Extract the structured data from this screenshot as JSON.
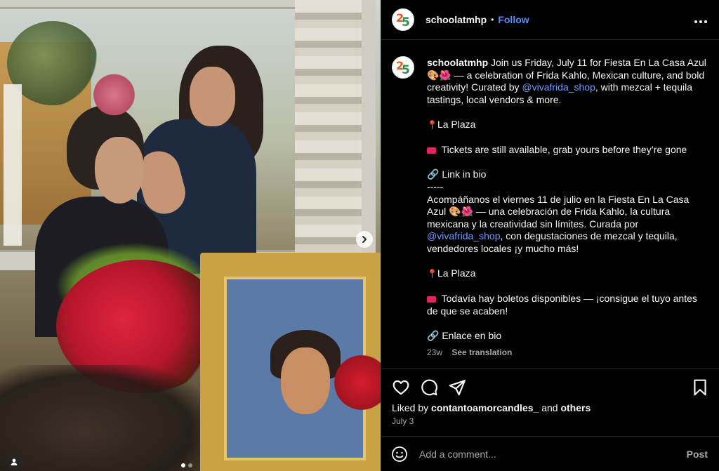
{
  "header": {
    "username": "schoolatmhp",
    "separator": "•",
    "follow_label": "Follow",
    "more_label": "•••"
  },
  "caption": {
    "username": "schoolatmhp",
    "line1": "Join us Friday, July 11 for Fiesta En La Casa Azul 🎨🌺 — a celebration of Frida Kahlo, Mexican culture, and bold creativity! Curated by ",
    "mention1": "@vivafrida_shop",
    "line1_end": ", with mezcal + tequila tastings, local vendors & more.",
    "location1": "La Plaza",
    "tickets1": "Tickets are still available, grab yours before they’re gone",
    "link1": "🔗 Link in bio",
    "divider": "-----",
    "es_line1": "Acompáñanos el viernes 11 de julio en la Fiesta En La Casa Azul 🎨🌺 — una celebración de Frida Kahlo, la cultura mexicana y la creatividad sin límites. Curada por ",
    "mention2": "@vivafrida_shop",
    "es_line1_end": ", con degustaciones de mezcal y tequila, vendedores locales ¡y mucho más!",
    "location2": "La Plaza",
    "tickets2": "Todavía hay boletos disponibles — ¡consigue el tuyo antes de que se acaben!",
    "link2": "🔗 Enlace en bio",
    "age": "23w",
    "see_translation": "See translation"
  },
  "likes": {
    "prefix": "Liked by",
    "user": "contantoamorcandles_",
    "middle": "and",
    "others": "others"
  },
  "date": "July 3",
  "comment_input": {
    "placeholder": "Add a comment...",
    "post_label": "Post"
  },
  "icons": {
    "like": "heart-icon",
    "comment": "comment-icon",
    "share": "share-icon",
    "save": "bookmark-icon",
    "emoji": "emoji-icon",
    "next": "chevron-right-icon",
    "tag": "user-tag-icon"
  },
  "colors": {
    "accent": "#5b8cff",
    "mention": "#6d9cff",
    "pin": "#e0245e"
  },
  "carousel": {
    "count": 2,
    "active": 1
  }
}
